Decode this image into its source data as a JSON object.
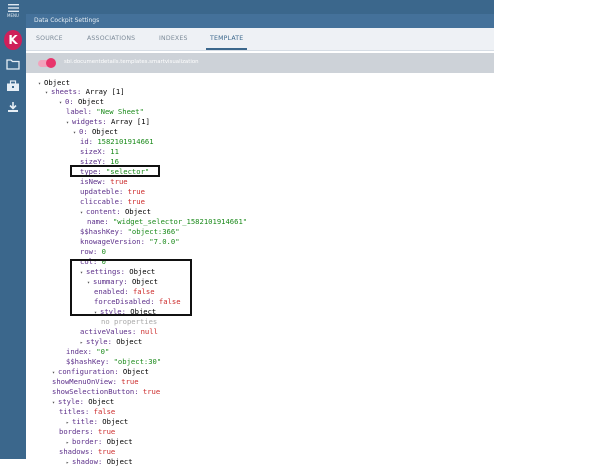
{
  "rail": {
    "menu_label": "MENU",
    "logo_letter": "K"
  },
  "window": {
    "title": "Data Cockpit Settings"
  },
  "tabs": [
    "SOURCE",
    "ASSOCIATIONS",
    "INDEXES",
    "TEMPLATE"
  ],
  "active_tab": "TEMPLATE",
  "toggle": {
    "label": "sbi.documentdetails.templates.smartvisualization",
    "on": true
  },
  "tree": [
    {
      "k": "Object",
      "v": "",
      "t": ""
    },
    {
      "k": "sheets",
      "v": "Array [1]",
      "t": "k"
    },
    {
      "k": "0",
      "v": "Object",
      "t": "k"
    },
    {
      "k": "label",
      "v": "\"New Sheet\"",
      "t": "sg"
    },
    {
      "k": "widgets",
      "v": "Array [1]",
      "t": "k"
    },
    {
      "k": "0",
      "v": "Object",
      "t": "k"
    },
    {
      "k": "id",
      "v": "1582101914661",
      "t": "sn"
    },
    {
      "k": "sizeX",
      "v": "11",
      "t": "sn"
    },
    {
      "k": "sizeY",
      "v": "16",
      "t": "sn"
    },
    {
      "k": "type",
      "v": "\"selector\"",
      "t": "sg"
    },
    {
      "k": "isNew",
      "v": "true",
      "t": "sb"
    },
    {
      "k": "updateble",
      "v": "true",
      "t": "sb"
    },
    {
      "k": "cliccable",
      "v": "true",
      "t": "sb"
    },
    {
      "k": "content",
      "v": "Object",
      "t": "k"
    },
    {
      "k": "name",
      "v": "\"widget_selector_1582101914661\"",
      "t": "sg"
    },
    {
      "k": "$$hashKey",
      "v": "\"object:366\"",
      "t": "sg"
    },
    {
      "k": "knowageVersion",
      "v": "\"7.0.0\"",
      "t": "sg"
    },
    {
      "k": "row",
      "v": "0",
      "t": "sn"
    },
    {
      "k": "col",
      "v": "0",
      "t": "sn"
    },
    {
      "k": "settings",
      "v": "Object",
      "t": "k"
    },
    {
      "k": "summary",
      "v": "Object",
      "t": "k"
    },
    {
      "k": "enabled",
      "v": "false",
      "t": "sb"
    },
    {
      "k": "forceDisabled",
      "v": "false",
      "t": "sb"
    },
    {
      "k": "style",
      "v": "Object",
      "t": "k"
    },
    {
      "k": "no properties",
      "v": "",
      "t": "dim"
    },
    {
      "k": "activeValues",
      "v": "null",
      "t": "sb"
    },
    {
      "k": "style",
      "v": "Object",
      "t": "k"
    },
    {
      "k": "index",
      "v": "\"0\"",
      "t": "sg"
    },
    {
      "k": "$$hashKey",
      "v": "\"object:30\"",
      "t": "sg"
    },
    {
      "k": "configuration",
      "v": "Object",
      "t": "k"
    },
    {
      "k": "showMenuOnView",
      "v": "true",
      "t": "sb"
    },
    {
      "k": "showSelectionButton",
      "v": "true",
      "t": "sb"
    },
    {
      "k": "style",
      "v": "Object",
      "t": "k"
    },
    {
      "k": "titles",
      "v": "false",
      "t": "sb"
    },
    {
      "k": "title",
      "v": "Object",
      "t": "k"
    },
    {
      "k": "borders",
      "v": "true",
      "t": "sb"
    },
    {
      "k": "border",
      "v": "Object",
      "t": "k"
    },
    {
      "k": "shadows",
      "v": "true",
      "t": "sb"
    },
    {
      "k": "shadow",
      "v": "Object",
      "t": "k"
    }
  ],
  "colors": {
    "rail": "#3b678c",
    "accent": "#e8346b",
    "key": "#5c2f8a",
    "string": "#1a8a1a",
    "boolean": "#cc2a2a"
  }
}
